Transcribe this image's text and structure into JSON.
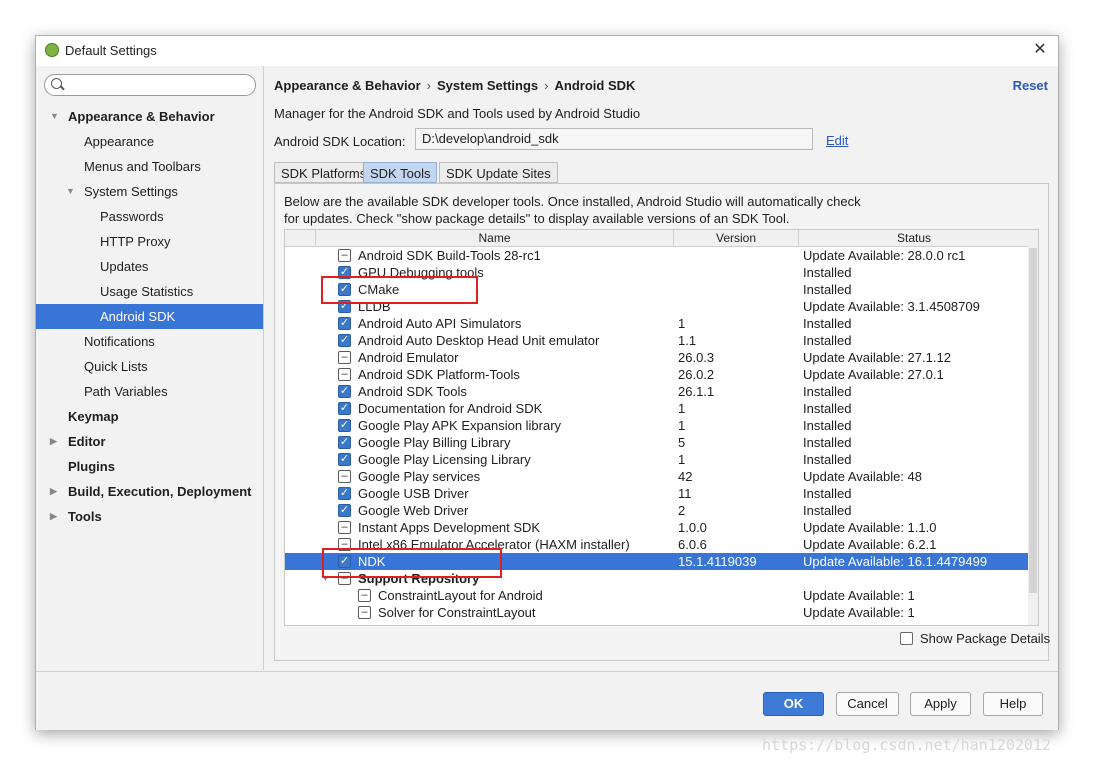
{
  "window": {
    "title": "Default Settings"
  },
  "sidebar": {
    "search_value": "",
    "items": [
      {
        "label": "Appearance & Behavior",
        "level": 0,
        "bold": true,
        "arrow": "expanded"
      },
      {
        "label": "Appearance",
        "level": 1
      },
      {
        "label": "Menus and Toolbars",
        "level": 1
      },
      {
        "label": "System Settings",
        "level": 1,
        "arrow": "expanded"
      },
      {
        "label": "Passwords",
        "level": 2
      },
      {
        "label": "HTTP Proxy",
        "level": 2
      },
      {
        "label": "Updates",
        "level": 2
      },
      {
        "label": "Usage Statistics",
        "level": 2
      },
      {
        "label": "Android SDK",
        "level": 2,
        "selected": true
      },
      {
        "label": "Notifications",
        "level": 1
      },
      {
        "label": "Quick Lists",
        "level": 1
      },
      {
        "label": "Path Variables",
        "level": 1
      },
      {
        "label": "Keymap",
        "level": 0,
        "bold": true
      },
      {
        "label": "Editor",
        "level": 0,
        "bold": true,
        "arrow": "collapsed"
      },
      {
        "label": "Plugins",
        "level": 0,
        "bold": true
      },
      {
        "label": "Build, Execution, Deployment",
        "level": 0,
        "bold": true,
        "arrow": "collapsed"
      },
      {
        "label": "Tools",
        "level": 0,
        "bold": true,
        "arrow": "collapsed"
      }
    ]
  },
  "header": {
    "breadcrumb": [
      "Appearance & Behavior",
      "System Settings",
      "Android SDK"
    ],
    "breadcrumb_sep": "›",
    "reset_label": "Reset"
  },
  "main": {
    "description": "Manager for the Android SDK and Tools used by Android Studio",
    "location_label": "Android SDK Location:",
    "location_value": "D:\\develop\\android_sdk",
    "edit_label": "Edit",
    "tabs": [
      {
        "label": "SDK Platforms",
        "active": false
      },
      {
        "label": "SDK Tools",
        "active": true
      },
      {
        "label": "SDK Update Sites",
        "active": false
      }
    ],
    "panel_desc_line1": "Below are the available SDK developer tools. Once installed, Android Studio will automatically check",
    "panel_desc_line2": "for updates. Check \"show package details\" to display available versions of an SDK Tool.",
    "columns": [
      "Name",
      "Version",
      "Status"
    ],
    "rows": [
      {
        "state": "partial",
        "name": "Android SDK Build-Tools 28-rc1",
        "version": "",
        "status": "Update Available: 28.0.0 rc1",
        "indent": 0
      },
      {
        "state": "checked",
        "name": "GPU Debugging tools",
        "version": "",
        "status": "Installed",
        "indent": 0
      },
      {
        "state": "checked",
        "name": "CMake",
        "version": "",
        "status": "Installed",
        "indent": 0
      },
      {
        "state": "checked",
        "name": "LLDB",
        "version": "",
        "status": "Update Available: 3.1.4508709",
        "indent": 0
      },
      {
        "state": "checked",
        "name": "Android Auto API Simulators",
        "version": "1",
        "status": "Installed",
        "indent": 0
      },
      {
        "state": "checked",
        "name": "Android Auto Desktop Head Unit emulator",
        "version": "1.1",
        "status": "Installed",
        "indent": 0
      },
      {
        "state": "partial",
        "name": "Android Emulator",
        "version": "26.0.3",
        "status": "Update Available: 27.1.12",
        "indent": 0
      },
      {
        "state": "partial",
        "name": "Android SDK Platform-Tools",
        "version": "26.0.2",
        "status": "Update Available: 27.0.1",
        "indent": 0
      },
      {
        "state": "checked",
        "name": "Android SDK Tools",
        "version": "26.1.1",
        "status": "Installed",
        "indent": 0
      },
      {
        "state": "checked",
        "name": "Documentation for Android SDK",
        "version": "1",
        "status": "Installed",
        "indent": 0
      },
      {
        "state": "checked",
        "name": "Google Play APK Expansion library",
        "version": "1",
        "status": "Installed",
        "indent": 0
      },
      {
        "state": "checked",
        "name": "Google Play Billing Library",
        "version": "5",
        "status": "Installed",
        "indent": 0
      },
      {
        "state": "checked",
        "name": "Google Play Licensing Library",
        "version": "1",
        "status": "Installed",
        "indent": 0
      },
      {
        "state": "partial",
        "name": "Google Play services",
        "version": "42",
        "status": "Update Available: 48",
        "indent": 0
      },
      {
        "state": "checked",
        "name": "Google USB Driver",
        "version": "11",
        "status": "Installed",
        "indent": 0
      },
      {
        "state": "checked",
        "name": "Google Web Driver",
        "version": "2",
        "status": "Installed",
        "indent": 0
      },
      {
        "state": "partial",
        "name": "Instant Apps Development SDK",
        "version": "1.0.0",
        "status": "Update Available: 1.1.0",
        "indent": 0
      },
      {
        "state": "partial",
        "name": "Intel x86 Emulator Accelerator (HAXM installer)",
        "version": "6.0.6",
        "status": "Update Available: 6.2.1",
        "indent": 0
      },
      {
        "state": "checked",
        "name": "NDK",
        "version": "15.1.4119039",
        "status": "Update Available: 16.1.4479499",
        "indent": 0,
        "selected": true
      },
      {
        "state": "partial",
        "name": "Support Repository",
        "version": "",
        "status": "",
        "indent": 0,
        "bold": true,
        "expandable": true
      },
      {
        "state": "partial",
        "name": "ConstraintLayout for Android",
        "version": "",
        "status": "Update Available: 1",
        "indent": 1
      },
      {
        "state": "partial",
        "name": "Solver for ConstraintLayout",
        "version": "",
        "status": "Update Available: 1",
        "indent": 1
      }
    ],
    "show_package_details_label": "Show Package Details"
  },
  "footer": {
    "ok_label": "OK",
    "cancel_label": "Cancel",
    "apply_label": "Apply",
    "help_label": "Help"
  },
  "watermark": "https://blog.csdn.net/han1202012",
  "colors": {
    "selection": "#3875d7",
    "link": "#2d58b6",
    "highlight_box": "#e02020"
  }
}
